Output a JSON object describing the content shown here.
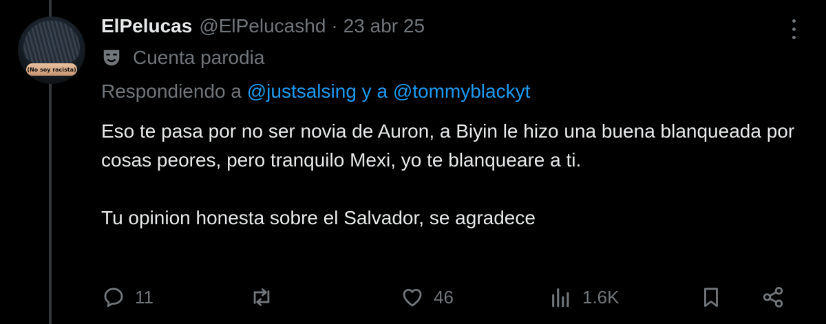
{
  "tweet": {
    "display_name": "ElPelucas",
    "handle": "@ElPelucashd",
    "separator": "·",
    "date": "23 abr 25",
    "parody_label": "Cuenta parodia",
    "avatar_text": "(No soy racista)",
    "reply": {
      "prefix": "Respondiendo a",
      "mention1": "@justsalsing",
      "conjunction": "y a",
      "mention2": "@tommyblackyt"
    },
    "body": {
      "paragraph1": "Eso te pasa por no ser novia de Auron, a Biyin le hizo una buena blanqueada por cosas peores, pero tranquilo Mexi, yo te blanqueare a ti.",
      "paragraph2": "Tu opinion honesta sobre el Salvador, se agradece"
    },
    "actions": {
      "replies": "11",
      "retweets": "",
      "likes": "46",
      "views": "1.6K"
    }
  },
  "icons": {
    "more": "more-vertical-icon",
    "parody": "parody-mask-icon",
    "reply": "reply-icon",
    "retweet": "retweet-icon",
    "like": "heart-icon",
    "views": "views-icon",
    "bookmark": "bookmark-icon",
    "share": "share-icon"
  },
  "colors": {
    "background": "#000000",
    "text": "#e7e9ea",
    "muted": "#71767b",
    "link": "#1d9bf0",
    "thread_line": "#333639"
  }
}
